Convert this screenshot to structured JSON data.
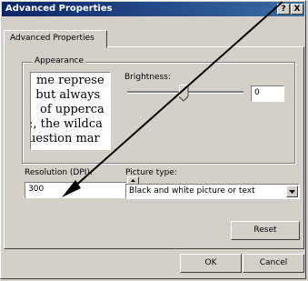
{
  "window": {
    "title": "Advanced Properties",
    "help_label": "?",
    "close_label": "X"
  },
  "tab": {
    "label": "Advanced Properties"
  },
  "appearance": {
    "group_label": "Appearance",
    "preview_lines": [
      "me represe",
      ", but always",
      "of upperca",
      ";, the wildca",
      "uestion mar"
    ]
  },
  "brightness": {
    "label": "Brightness:",
    "value": "0",
    "level": 0.5
  },
  "resolution": {
    "label": "Resolution (DPI):",
    "value": "300"
  },
  "picture_type": {
    "label": "Picture type:",
    "selected": "Black and white picture or text"
  },
  "buttons": {
    "reset": "Reset",
    "ok": "OK",
    "cancel": "Cancel"
  },
  "icons": {
    "spin_up": "spin-up-icon",
    "spin_down": "spin-down-icon",
    "dropdown": "chevron-down-icon",
    "annotation": "arrow-annotation"
  }
}
